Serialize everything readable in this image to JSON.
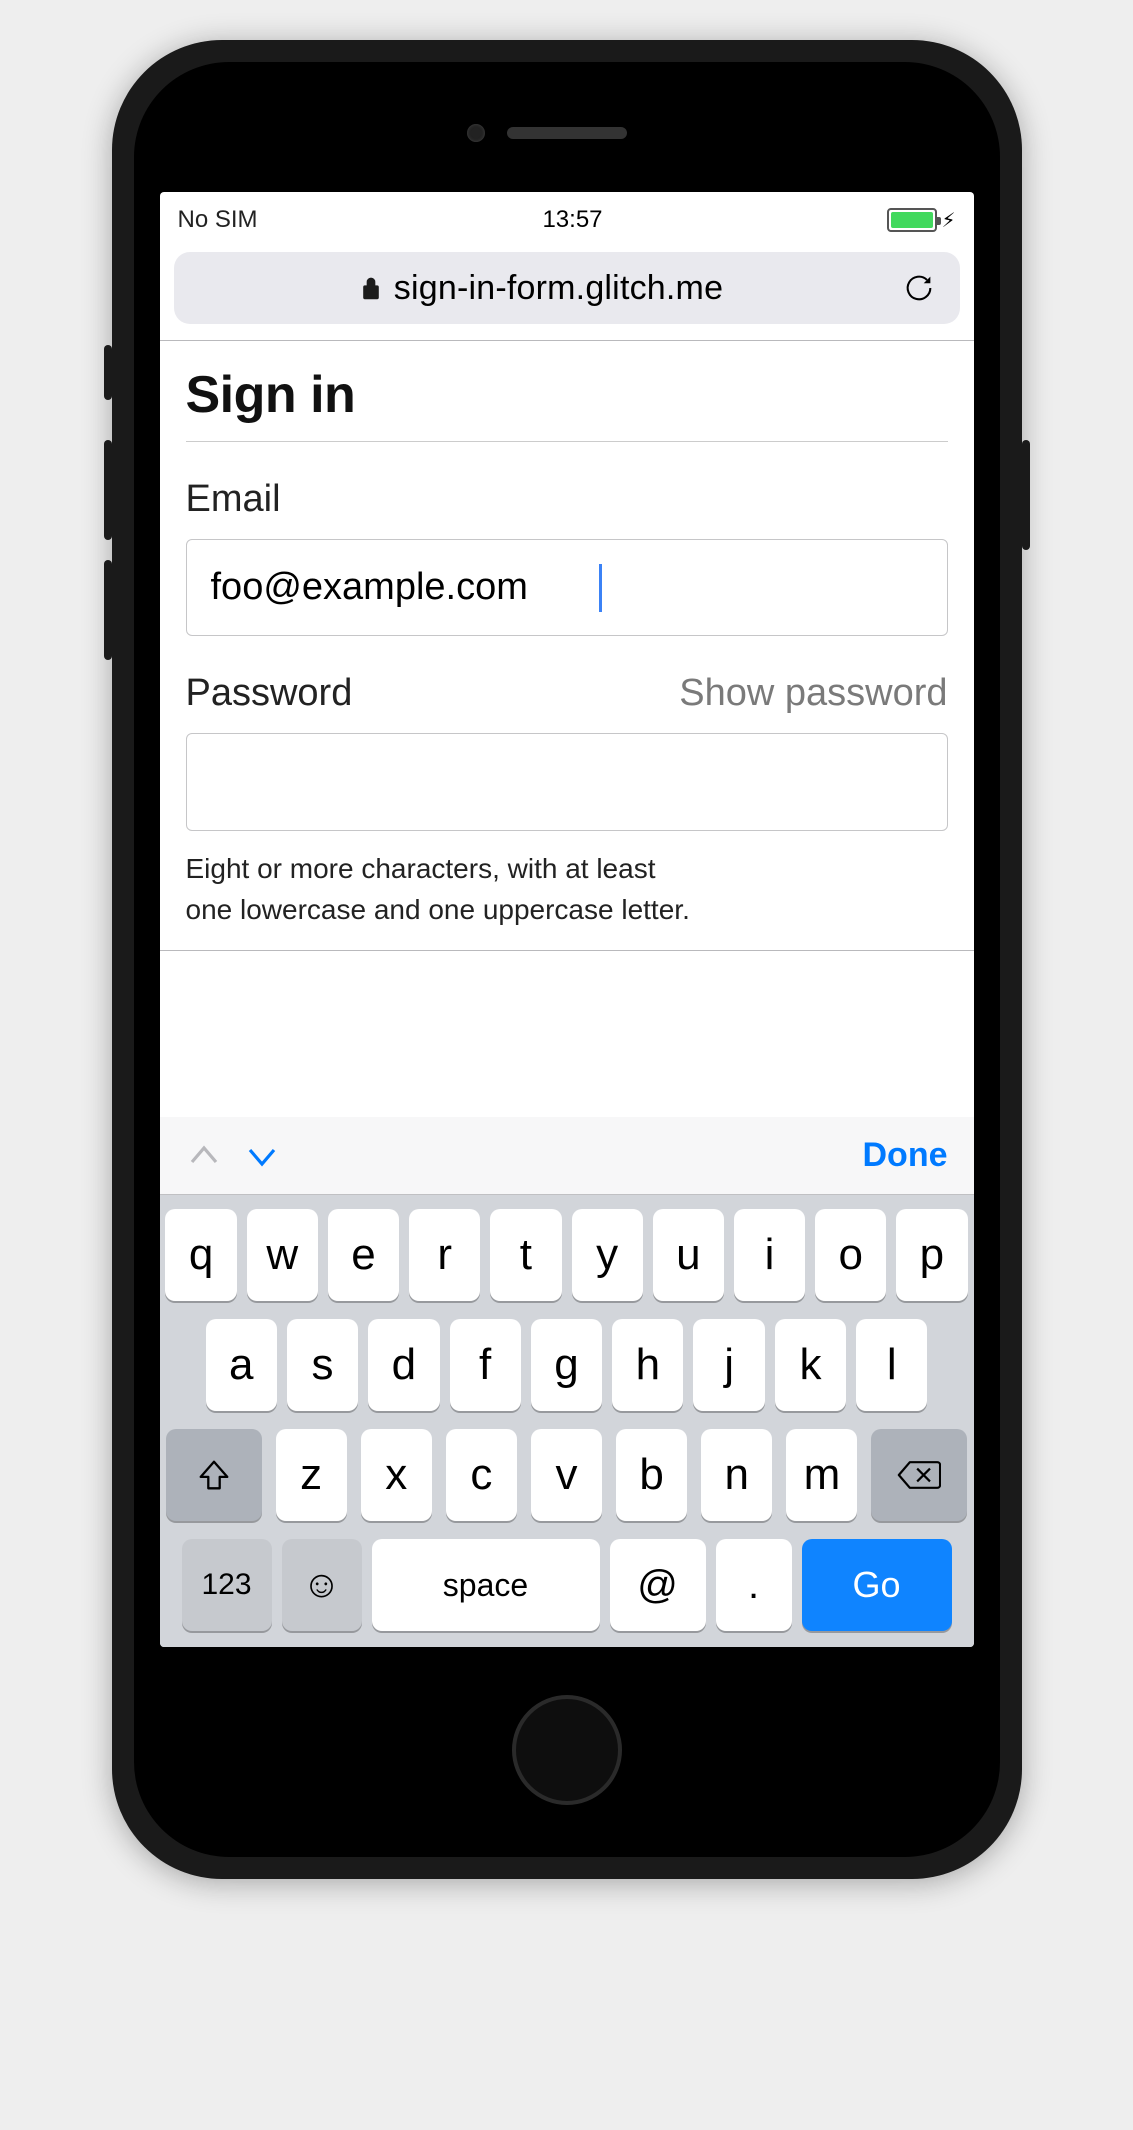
{
  "status": {
    "carrier": "No SIM",
    "time": "13:57"
  },
  "browser": {
    "url": "sign-in-form.glitch.me"
  },
  "page": {
    "title": "Sign in",
    "email_label": "Email",
    "email_value": "foo@example.com",
    "password_label": "Password",
    "show_password": "Show password",
    "password_value": "",
    "hint_line1": "Eight or more characters, with at least",
    "hint_line2": "one lowercase and one uppercase letter."
  },
  "kb_accessory": {
    "done": "Done"
  },
  "keyboard": {
    "row1": [
      "q",
      "w",
      "e",
      "r",
      "t",
      "y",
      "u",
      "i",
      "o",
      "p"
    ],
    "row2": [
      "a",
      "s",
      "d",
      "f",
      "g",
      "h",
      "j",
      "k",
      "l"
    ],
    "row3": [
      "z",
      "x",
      "c",
      "v",
      "b",
      "n",
      "m"
    ],
    "mode_key": "123",
    "space": "space",
    "at": "@",
    "dot": ".",
    "go": "Go"
  }
}
